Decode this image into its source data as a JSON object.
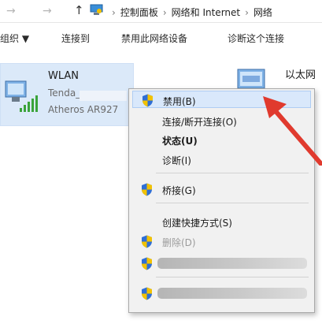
{
  "address_bar": {
    "back_glyph": "→",
    "forward_glyph": "→",
    "up_glyph": "↑",
    "crumbs": [
      "控制面板",
      "网络和 Internet",
      "网络"
    ]
  },
  "command_bar": {
    "organize": "组织 ▼",
    "connect_to": "连接到",
    "disable_device": "禁用此网络设备",
    "diagnose": "诊断这个连接"
  },
  "connections": {
    "wlan": {
      "name": "WLAN",
      "ssid": "Tenda_",
      "adapter": "Atheros AR927"
    },
    "ethernet": {
      "name": "以太网"
    }
  },
  "context_menu": {
    "items": [
      {
        "label": "禁用(B)",
        "shield": true
      },
      {
        "label": "连接/断开连接(O)"
      },
      {
        "label": "状态(U)",
        "bold": true
      },
      {
        "label": "诊断(I)"
      },
      {
        "label": "桥接(G)",
        "shield": true
      },
      {
        "label": "创建快捷方式(S)"
      },
      {
        "label": "删除(D)",
        "shield": true,
        "disabled": true
      }
    ]
  },
  "colors": {
    "highlight": "#d9e8fb",
    "arrow": "#e03a2e",
    "shield_blue": "#2f6fd6",
    "shield_yellow": "#f2c200"
  },
  "icons": {
    "shield": "uac-shield-icon",
    "wlan": "wireless-adapter-icon",
    "ethernet": "ethernet-adapter-icon",
    "arrow": "red-pointer-arrow"
  }
}
